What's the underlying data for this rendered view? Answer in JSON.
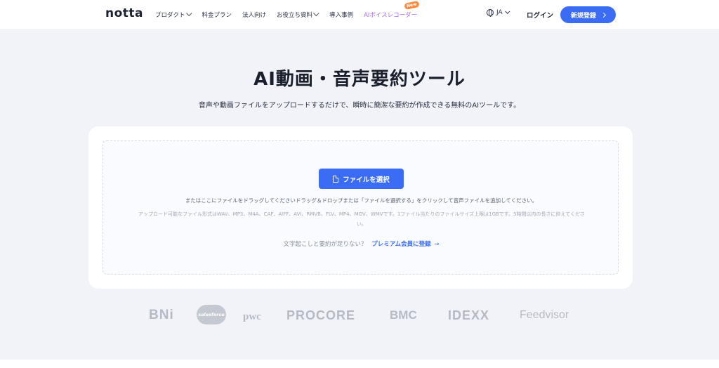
{
  "nav": {
    "logo": "notta",
    "items": [
      {
        "label": "プロダクト",
        "has_dropdown": true
      },
      {
        "label": "料金プラン",
        "has_dropdown": false
      },
      {
        "label": "法人向け",
        "has_dropdown": false
      },
      {
        "label": "お役立ち資料",
        "has_dropdown": true
      },
      {
        "label": "導入事例",
        "has_dropdown": false
      },
      {
        "label": "AIボイスレコーダー",
        "has_dropdown": false,
        "badge": "New"
      }
    ],
    "language": "JA",
    "login_label": "ログイン",
    "signup_label": "新規登録"
  },
  "hero": {
    "title": "AI動画・音声要約ツール",
    "subtitle": "音声や動画ファイルをアップロードするだけで、瞬時に簡潔な要約が作成できる無料のAIツールです。"
  },
  "upload": {
    "button_label": "ファイルを選択",
    "drop_text": "またはここにファイルをドラッグしてくださいドラッグ＆ドロップまたは「ファイルを選択する」をクリックして音声ファイルを追加してください。",
    "formats_text": "アップロード可能なファイル形式はWAV、MP3、M4A、CAF、AIFF、AVI、RMVB、FLV、MP4、MOV、WMVです。1ファイル当たりのファイルサイズ上限は1GBです。5時間以内の長さに抑えてください。",
    "premium_prompt": "文字起こしと要約が足りない？",
    "premium_link": "プレミアム会員に登録",
    "premium_arrow": "→"
  },
  "logos": [
    "BNi",
    "salesforce",
    "pwc",
    "PROCORE",
    "BMC",
    "IDEXX",
    "Feedvisor"
  ],
  "colors": {
    "accent": "#3b6cf5",
    "background": "#f1f3f8",
    "highlight_menu": "#a86cf0",
    "badge": "#ff8a3d",
    "logo_gray": "#b6bac4"
  }
}
